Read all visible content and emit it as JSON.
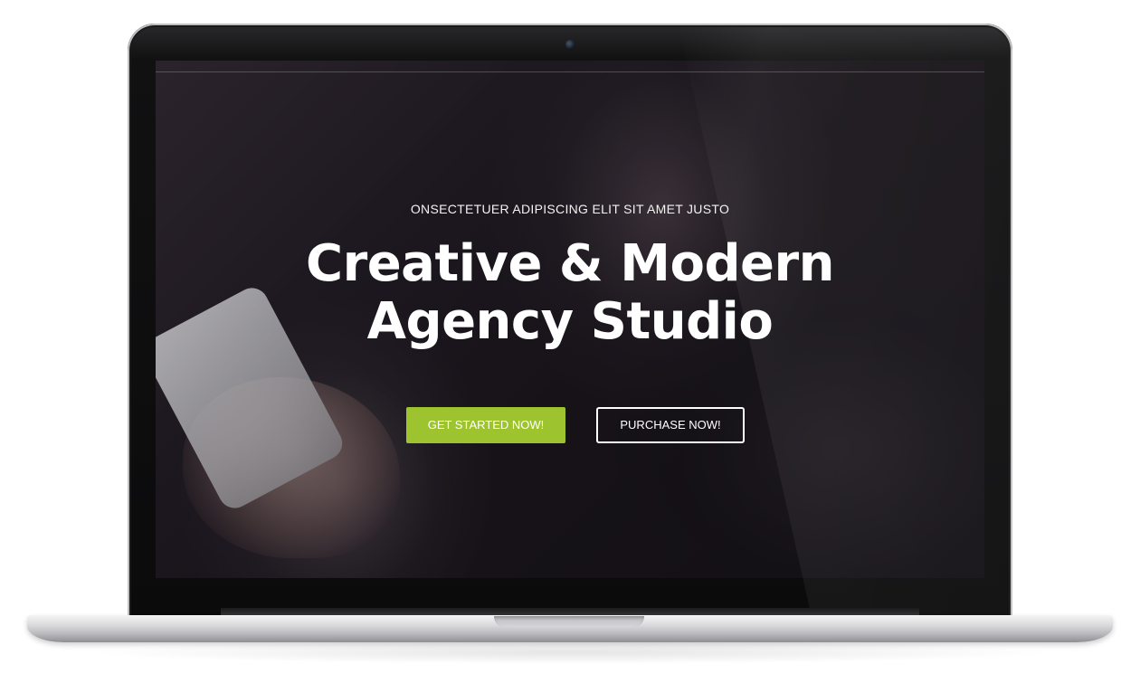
{
  "hero": {
    "tagline": "ONSECTETUER ADIPISCING ELIT SIT AMET JUSTO",
    "headline_line1": "Creative & Modern",
    "headline_line2": "Agency Studio",
    "primary_button_label": "GET STARTED NOW!",
    "secondary_button_label": "PURCHASE NOW!"
  },
  "colors": {
    "accent": "#9dc42e",
    "text": "#ffffff",
    "overlay": "#1a1519"
  },
  "device": {
    "type": "laptop-mockup",
    "camera_icon": "camera-icon"
  }
}
